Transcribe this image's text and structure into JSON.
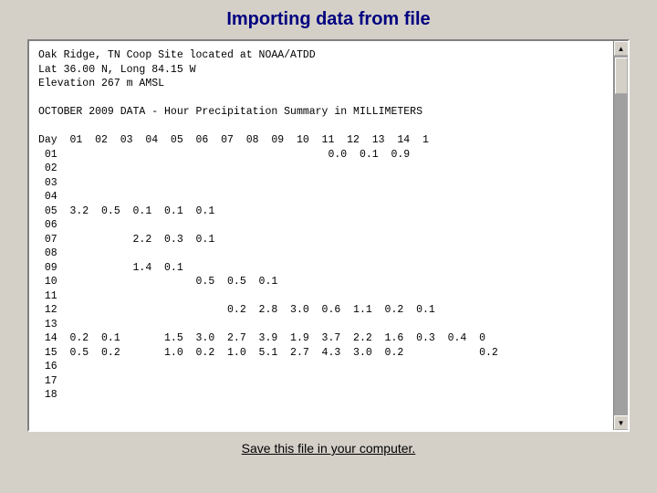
{
  "page": {
    "title": "Importing data from file",
    "bottom_text": "Save this file in your computer."
  },
  "file_content": {
    "lines": [
      "Oak Ridge, TN Coop Site located at NOAA/ATDD",
      "Lat 36.00 N, Long 84.15 W",
      "Elevation 267 m AMSL",
      "",
      "OCTOBER 2009 DATA - Hour Precipitation Summary in MILLIMETERS",
      "",
      "Day  01  02  03  04  05  06  07  08  09  10  11  12  13  14  1",
      " 01                                           0.0  0.1  0.9",
      " 02",
      " 03",
      " 04",
      " 05  3.2  0.5  0.1  0.1  0.1",
      " 06",
      " 07            2.2  0.3  0.1",
      " 08",
      " 09            1.4  0.1",
      " 10                      0.5  0.5  0.1",
      " 11",
      " 12                           0.2  2.8  3.0  0.6  1.1  0.2  0.1",
      " 13",
      " 14  0.2  0.1       1.5  3.0  2.7  3.9  1.9  3.7  2.2  1.6  0.3  0.4  0",
      " 15  0.5  0.2       1.0  0.2  1.0  5.1  2.7  4.3  3.0  0.2            0.2",
      " 16",
      " 17",
      " 18"
    ]
  }
}
